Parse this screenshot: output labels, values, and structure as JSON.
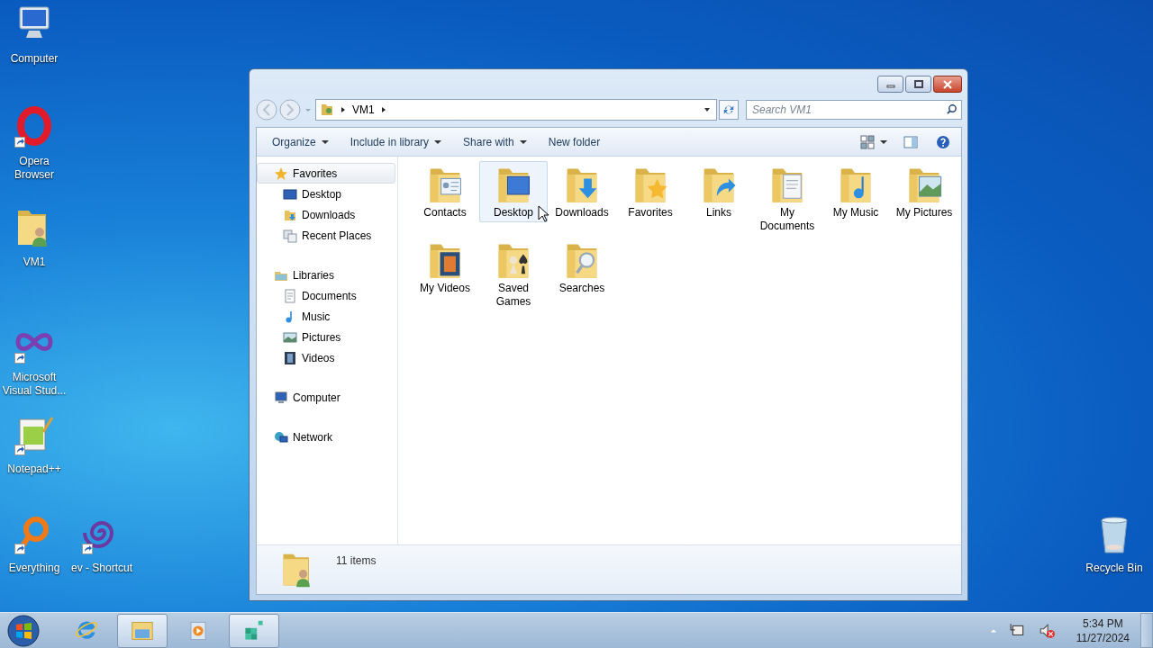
{
  "desktop_icons": [
    {
      "kind": "computer",
      "label": "Computer",
      "shortcut": false
    },
    {
      "kind": "opera",
      "label": "Opera Browser",
      "shortcut": true
    },
    {
      "kind": "user-folder",
      "label": "VM1",
      "shortcut": false
    },
    {
      "kind": "visual-studio",
      "label": "Microsoft Visual Stud...",
      "shortcut": true
    },
    {
      "kind": "notepad",
      "label": "Notepad++",
      "shortcut": true
    },
    {
      "kind": "everything",
      "label": "Everything",
      "shortcut": true
    },
    {
      "kind": "spiral",
      "label": "ev - Shortcut",
      "shortcut": true
    },
    {
      "kind": "recycle-bin",
      "label": "Recycle Bin",
      "shortcut": false
    }
  ],
  "window": {
    "address": {
      "segments": [
        "VM1"
      ]
    },
    "search": {
      "placeholder": "Search VM1"
    },
    "toolbar": [
      {
        "label": "Organize",
        "dropdown": true
      },
      {
        "label": "Include in library",
        "dropdown": true
      },
      {
        "label": "Share with",
        "dropdown": true
      },
      {
        "label": "New folder",
        "dropdown": false
      }
    ],
    "nav_groups": [
      {
        "kind": "favorites",
        "label": "Favorites",
        "selected": true,
        "children": [
          {
            "kind": "desktop",
            "label": "Desktop",
            "selected": false
          },
          {
            "kind": "downloads",
            "label": "Downloads",
            "selected": false
          },
          {
            "kind": "recent",
            "label": "Recent Places",
            "selected": false
          }
        ]
      },
      {
        "kind": "libraries",
        "label": "Libraries",
        "selected": false,
        "children": [
          {
            "kind": "documents",
            "label": "Documents",
            "selected": false
          },
          {
            "kind": "music",
            "label": "Music",
            "selected": false
          },
          {
            "kind": "pictures",
            "label": "Pictures",
            "selected": false
          },
          {
            "kind": "videos",
            "label": "Videos",
            "selected": false
          }
        ]
      },
      {
        "kind": "computer",
        "label": "Computer",
        "selected": false
      },
      {
        "kind": "network",
        "label": "Network",
        "selected": false
      }
    ],
    "folders": [
      {
        "kind": "contacts",
        "label": "Contacts",
        "selected": false
      },
      {
        "kind": "desktop",
        "label": "Desktop",
        "selected": true
      },
      {
        "kind": "downloads",
        "label": "Downloads",
        "selected": false
      },
      {
        "kind": "favorites",
        "label": "Favorites",
        "selected": false
      },
      {
        "kind": "links",
        "label": "Links",
        "selected": false
      },
      {
        "kind": "documents",
        "label": "My Documents",
        "selected": false
      },
      {
        "kind": "music",
        "label": "My Music",
        "selected": false
      },
      {
        "kind": "pictures",
        "label": "My Pictures",
        "selected": false
      },
      {
        "kind": "videos",
        "label": "My Videos",
        "selected": false
      },
      {
        "kind": "games",
        "label": "Saved Games",
        "selected": false
      },
      {
        "kind": "searches",
        "label": "Searches",
        "selected": false
      }
    ],
    "status": {
      "count": "11 items"
    }
  },
  "taskbar": {
    "items": [
      {
        "kind": "ie",
        "active": false
      },
      {
        "kind": "explorer",
        "active": true
      },
      {
        "kind": "media",
        "active": false
      },
      {
        "kind": "registry",
        "active": true
      }
    ],
    "clock": {
      "time": "5:34 PM",
      "date": "11/27/2024"
    }
  }
}
